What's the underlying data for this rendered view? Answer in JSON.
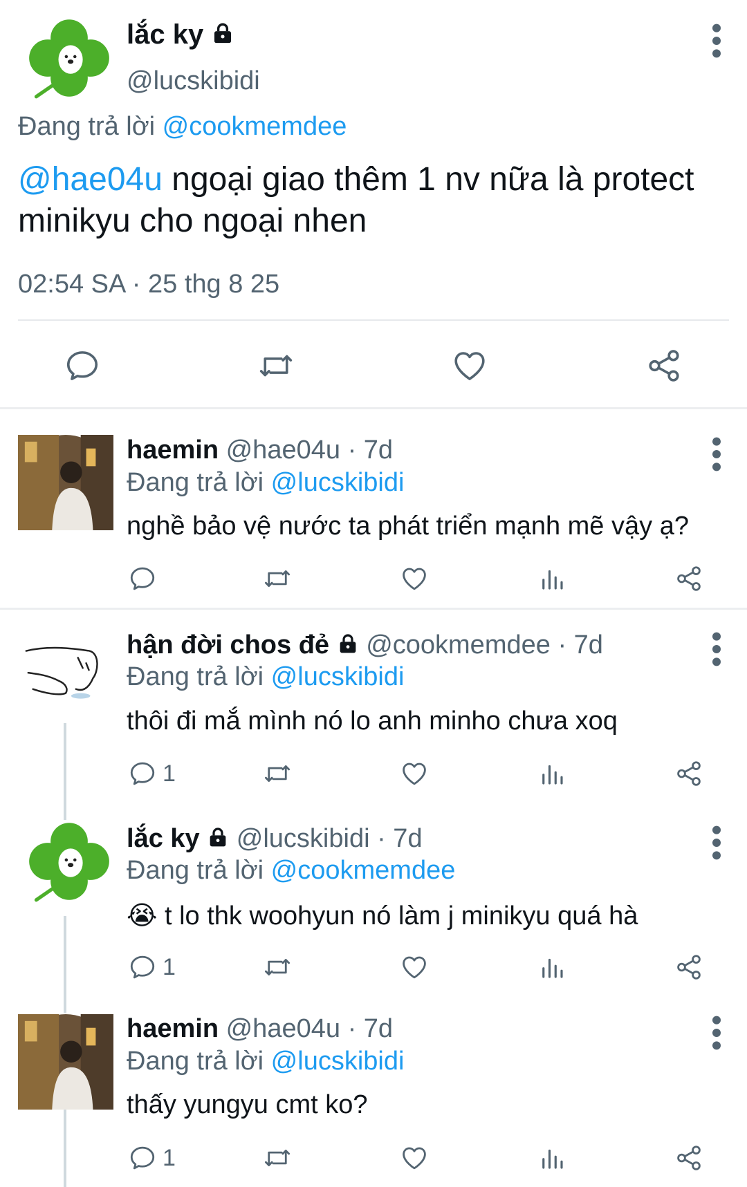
{
  "main_tweet": {
    "name": "lắc ky",
    "handle": "@lucskibidi",
    "replying_prefix": "Đang trả lời",
    "replying_to": "@cookmemdee",
    "mention": "@hae04u",
    "text": " ngoại giao thêm 1 nv nữa là protect minikyu cho ngoại nhen",
    "timestamp": "02:54 SA · 25 thg 8 25"
  },
  "replies": [
    {
      "name": "haemin",
      "handle": "@hae04u",
      "time": "· 7d",
      "replying_prefix": "Đang trả lời",
      "replying_to": "@lucskibidi",
      "text": "nghề bảo vệ nước ta phát triển mạnh mẽ vậy ạ?",
      "reply_count": ""
    },
    {
      "name": "hận đời chos đẻ",
      "handle": "@cookmemdee",
      "time": "· 7d",
      "replying_prefix": "Đang trả lời",
      "replying_to": "@lucskibidi",
      "text": "thôi đi mắ mình nó lo anh minho chưa xoq",
      "reply_count": "1"
    },
    {
      "name": "lắc ky",
      "handle": "@lucskibidi",
      "time": "· 7d",
      "replying_prefix": "Đang trả lời",
      "replying_to": "@cookmemdee",
      "emoji": "😭",
      "text": " t lo thk woohyun nó làm j minikyu quá hà",
      "reply_count": "1"
    },
    {
      "name": "haemin",
      "handle": "@hae04u",
      "time": "· 7d",
      "replying_prefix": "Đang trả lời",
      "replying_to": "@lucskibidi",
      "text": "thấy yungyu cmt ko?",
      "reply_count": "1"
    }
  ],
  "icons": {
    "reply": "reply-icon",
    "retweet": "retweet-icon",
    "like": "heart-icon",
    "views": "views-icon",
    "share": "share-icon",
    "more": "more-vertical-icon",
    "lock": "lock-icon"
  },
  "colors": {
    "link": "#1d9bf0",
    "muted": "#536471",
    "text": "#0f1419",
    "icon": "#536471"
  }
}
